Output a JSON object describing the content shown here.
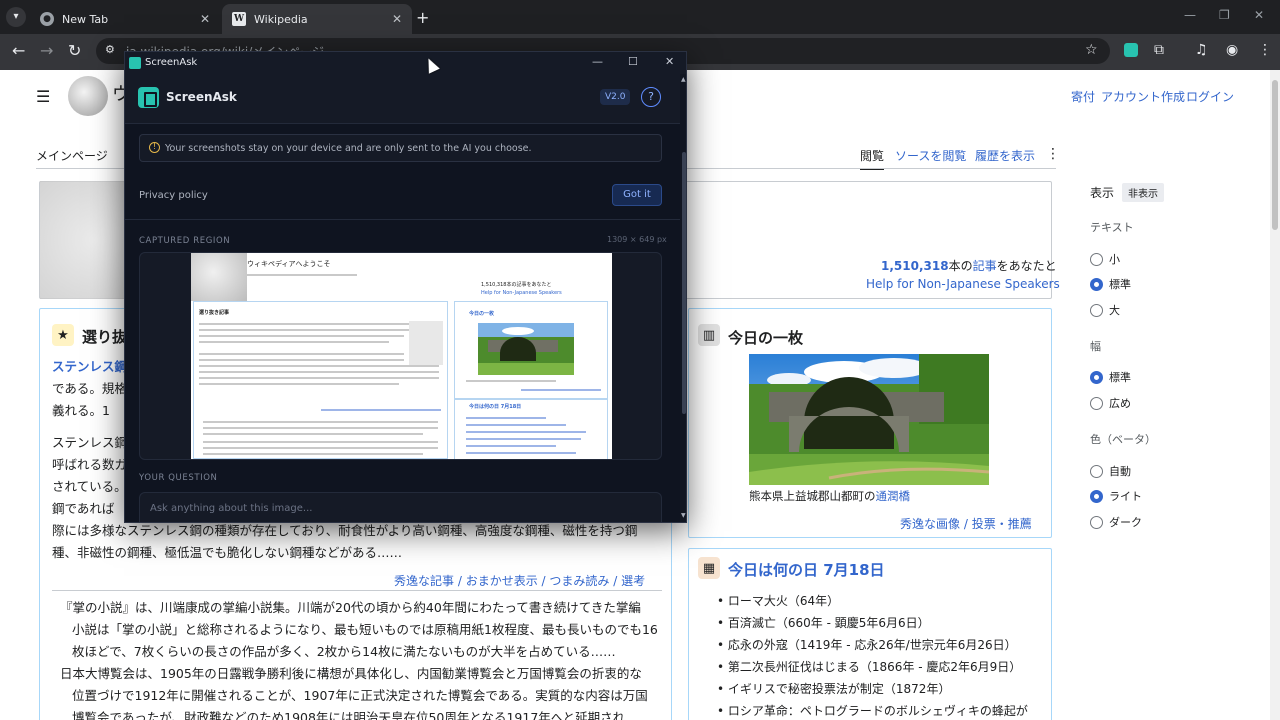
{
  "browser": {
    "tabs": [
      {
        "title": "New Tab",
        "active": false
      },
      {
        "title": "Wikipedia",
        "active": true
      }
    ],
    "url": "ja.wikipedia.org/wiki/メインページ"
  },
  "wikipedia": {
    "logo_text": "ウ",
    "user_links": [
      "寄付",
      "アカウント作成",
      "ログイン"
    ],
    "main_tab": "メインページ",
    "view_tabs": [
      "閲覧",
      "ソースを閲覧",
      "履歴を表示"
    ],
    "welcome": {
      "stats_prefix": "1,510,318",
      "stats_suffix": "本の",
      "stats_link": "記事",
      "stats_tail": "をあなたと",
      "help_link": "Help for Non-Japanese Speakers"
    },
    "featured": {
      "title": "選り抜",
      "lines": [
        "ステンレス鋼",
        "である。規格",
        "義れる。1",
        "ステンレス鋼",
        "呼ばれる数ガ",
        "されている。",
        "鋼であれば",
        "際には多様なステンレス鋼の種類が存在しており、耐食性がより高い鋼種、高強度な鋼種、磁性を持つ鋼",
        "種、非磁性の鋼種、極低温でも脆化しない鋼種などがある……"
      ],
      "footer_links": [
        "秀逸な記事",
        "おまかせ表示",
        "つまみ読み",
        "選考"
      ],
      "news": [
        "『掌の小説』は、川端康成の掌編小説集。川端が20代の頃から約40年間にわたって書き続けてきた掌編",
        "小説は「掌の小説」と総称されるようになり、最も短いものでは原稿用紙1枚程度、最も長いものでも16",
        "枚ほどで、7枚くらいの長さの作品が多く、2枚から14枚に満たないものが大半を占めている……",
        "日本大博覧会は、1905年の日露戦争勝利後に構想が具体化し、内国勧業博覧会と万国博覧会の折衷的な",
        "位置づけで1912年に開催されることが、1907年に正式決定された博覧会である。実質的な内容は万国",
        "博覧会であったが、財政難などのため1908年には明治天皇在位50周年となる1917年へと延期され"
      ]
    },
    "picture": {
      "title": "今日の一枚",
      "caption_prefix": "熊本県上益城郡山都町の",
      "caption_link": "通潤橋",
      "footer_links": [
        "秀逸な画像",
        "投票",
        "推薦"
      ]
    },
    "onthisday": {
      "title": "今日は何の日 7月18日",
      "items": [
        "ローマ大火（64年）",
        "百済滅亡（660年 - 顕慶5年6月6日）",
        "応永の外寇（1419年 - 応永26年/世宗元年6月26日）",
        "第二次長州征伐はじまる（1866年 - 慶応2年6月9日）",
        "イギリスで秘密投票法が制定（1872年）",
        "ロシア革命：ペトログラードのボルシェヴィキの蜂起が"
      ]
    },
    "sidebar": {
      "display_label": "表示",
      "hide_label": "非表示",
      "text_label": "テキスト",
      "text_options": [
        "小",
        "標準",
        "大"
      ],
      "text_selected": 1,
      "width_label": "幅",
      "width_options": [
        "標準",
        "広め"
      ],
      "width_selected": 0,
      "color_label": "色（ベータ）",
      "color_options": [
        "自動",
        "ライト",
        "ダーク"
      ],
      "color_selected": 1
    }
  },
  "screenask": {
    "window_title": "ScreenAsk",
    "app_name": "ScreenAsk",
    "version": "V2.0",
    "help_icon": "?",
    "notice": "Your screenshots stay on your device and are only sent to the AI you choose.",
    "privacy_label": "Privacy policy",
    "got_it_label": "Got it",
    "captured_label": "CAPTURED REGION",
    "captured_dims": "1309 × 649 px",
    "mini_title": "ウィキペディアへようこそ",
    "mini_stats": "1,510,318本の記事をあなたと",
    "mini_help": "Help for Non-Japanese Speakers",
    "mini_featured": "選り抜き記事",
    "mini_picture": "今日の一枚",
    "mini_onthisday": "今日は何の日 7月18日",
    "question_label": "YOUR QUESTION",
    "question_placeholder": "Ask anything about this image..."
  },
  "colors": {
    "accent": "#28c3b0",
    "link": "#3366cc",
    "app_bg": "#0f1420"
  },
  "icons": {
    "back": "arrow-left-icon",
    "forward": "arrow-right-icon",
    "reload": "reload-icon",
    "star": "star-icon",
    "help": "question-circle-icon",
    "warning": "info-icon"
  }
}
